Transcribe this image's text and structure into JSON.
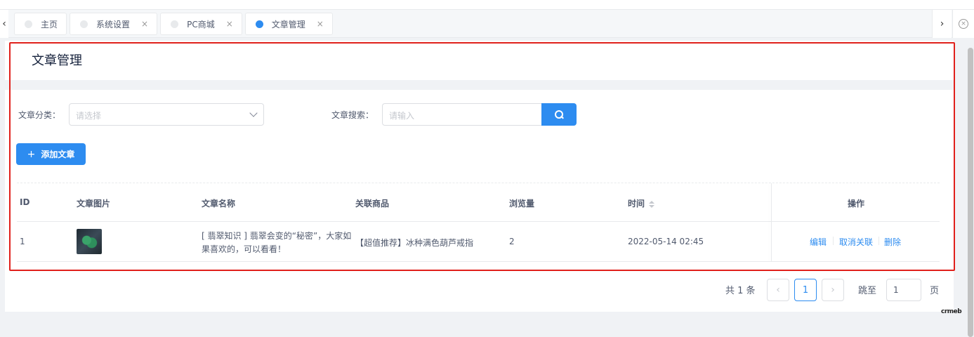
{
  "tabbar": {
    "tabs": [
      {
        "label": "主页",
        "active": false,
        "closable": false
      },
      {
        "label": "系统设置",
        "active": false,
        "closable": true
      },
      {
        "label": "PC商城",
        "active": false,
        "closable": true
      },
      {
        "label": "文章管理",
        "active": true,
        "closable": true
      }
    ],
    "close_glyph": "×",
    "nav_left": "‹",
    "nav_right": "›",
    "close_all": "×"
  },
  "page": {
    "title": "文章管理"
  },
  "filters": {
    "category_label": "文章分类：",
    "category_placeholder": "请选择",
    "search_label": "文章搜索：",
    "search_placeholder": "请输入"
  },
  "toolbar": {
    "add_icon": "+",
    "add_label": "添加文章"
  },
  "table": {
    "columns": [
      "ID",
      "文章图片",
      "文章名称",
      "关联商品",
      "浏览量",
      "时间",
      "操作"
    ],
    "rows": [
      {
        "id": "1",
        "image": "jade-bracelet-thumbnail",
        "name_line1": "[ 翡翠知识 ] 翡翠会变的“秘密”，大家如",
        "name_line2": "果喜欢的，可以看看！",
        "product": "【超值推荐】冰种满色葫芦戒指",
        "views": "2",
        "time": "2022-05-14 02:45",
        "actions": [
          "编辑",
          "取消关联",
          "删除"
        ]
      }
    ]
  },
  "pagination": {
    "total": "共 1 条",
    "prev": "‹",
    "current_page": "1",
    "next": "›",
    "jump_label": "跳至",
    "jump_value": "1",
    "page_suffix": "页"
  },
  "watermark": "crmeb",
  "colors": {
    "primary": "#2d8cf0",
    "highlight_border": "#e0201b",
    "background": "#f0f2f5"
  }
}
